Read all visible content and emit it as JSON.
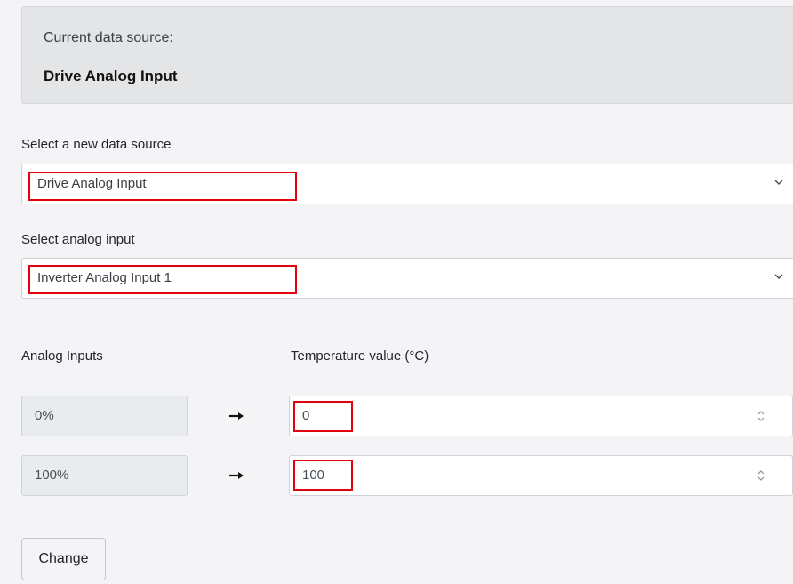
{
  "current_source": {
    "label": "Current data source:",
    "value": "Drive Analog Input"
  },
  "new_source": {
    "label": "Select a new data source",
    "selected": "Drive Analog Input"
  },
  "analog_input": {
    "label": "Select analog input",
    "selected": "Inverter Analog Input 1"
  },
  "mapping": {
    "col_left": "Analog Inputs",
    "col_right": "Temperature value (°C)",
    "rows": [
      {
        "input": "0%",
        "value": "0"
      },
      {
        "input": "100%",
        "value": "100"
      }
    ]
  },
  "actions": {
    "change_label": "Change"
  },
  "colors": {
    "highlight": "#e3000f"
  }
}
